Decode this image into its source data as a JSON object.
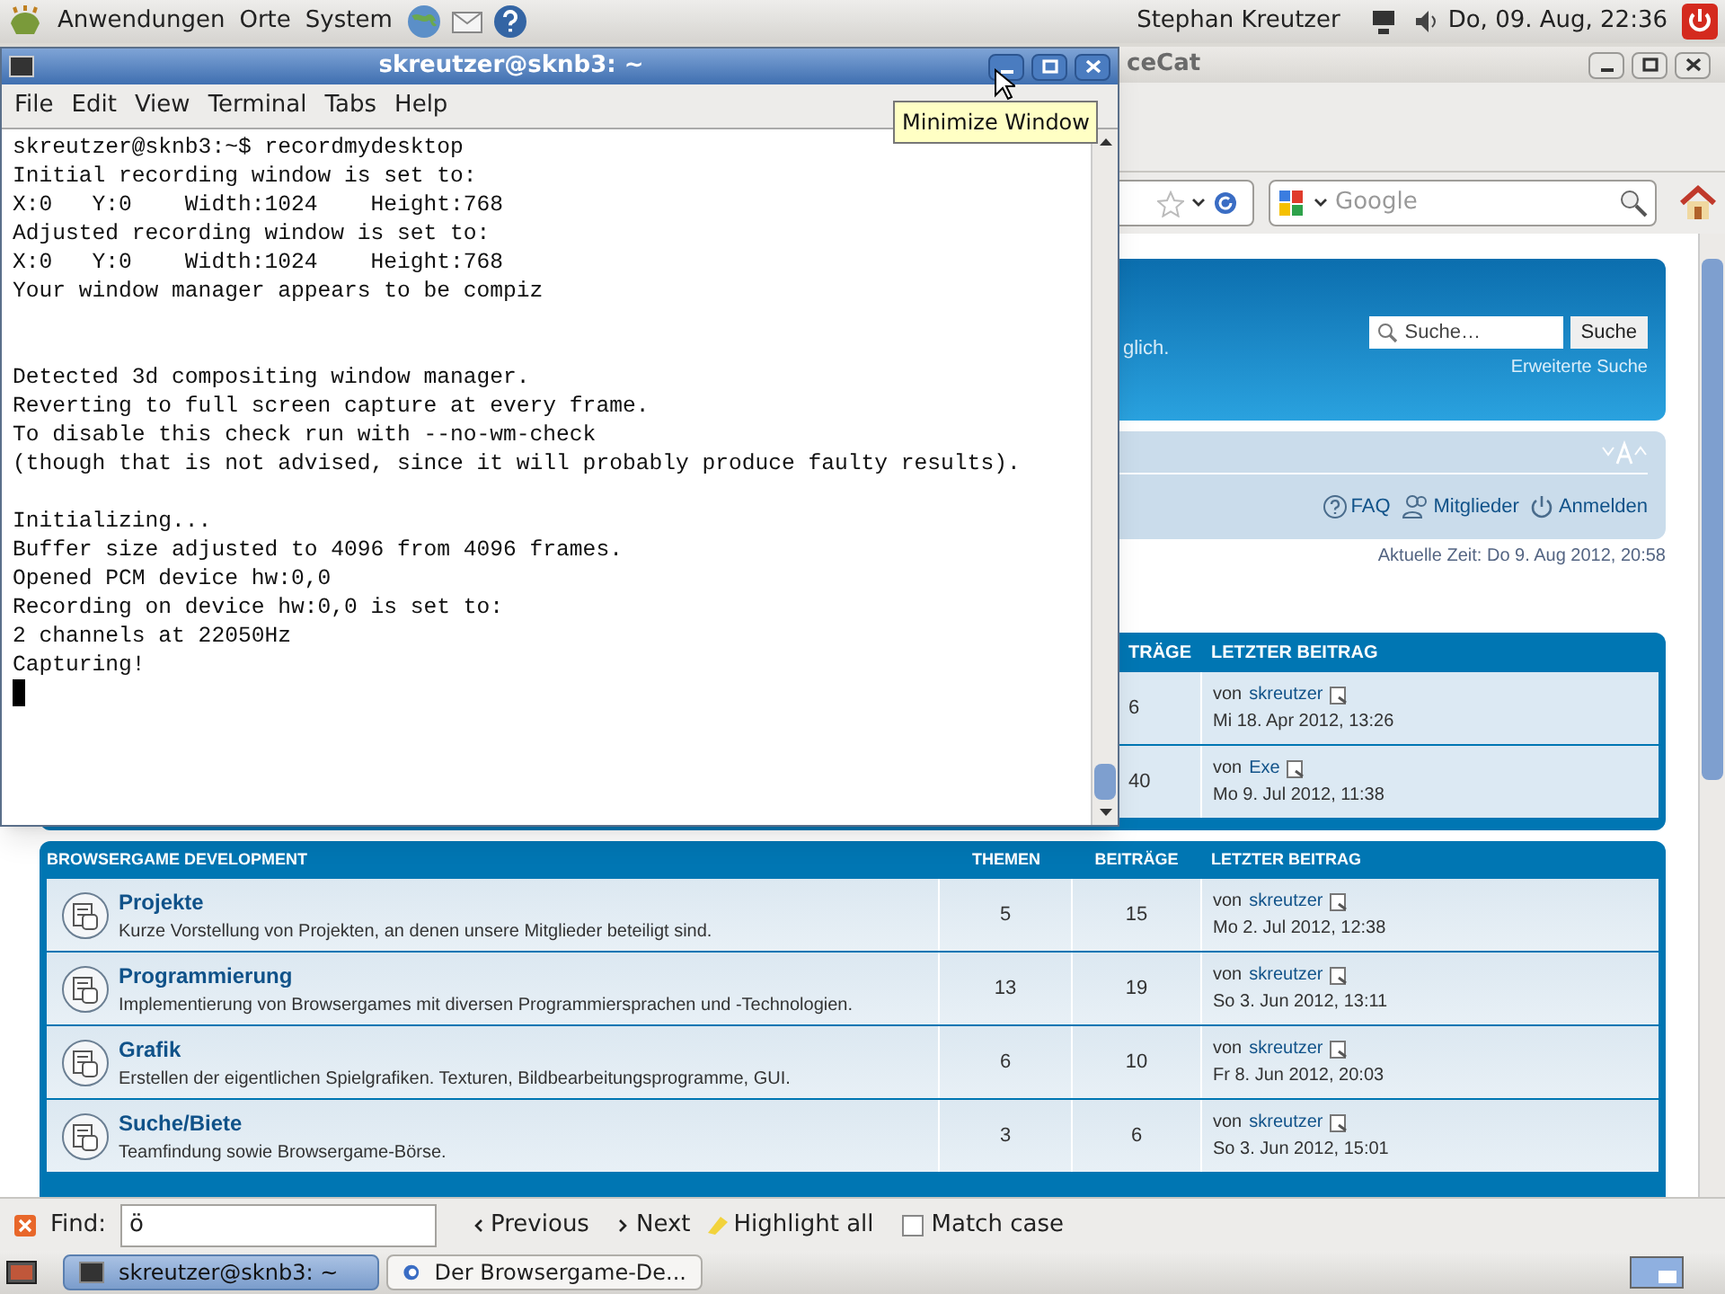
{
  "top_panel": {
    "menus": [
      "Anwendungen",
      "Orte",
      "System"
    ],
    "user": "Stephan Kreutzer",
    "clock": "Do, 09. Aug, 22:36"
  },
  "browser": {
    "title": "ceCat",
    "search_placeholder": "Google",
    "header": {
      "text": "glich.",
      "search_placeholder": "Suche…",
      "search_button": "Suche",
      "advanced_link": "Erweiterte Suche"
    },
    "nav_links": [
      {
        "kind": "faq",
        "label": "FAQ"
      },
      {
        "kind": "members",
        "label": "Mitglieder"
      },
      {
        "kind": "login",
        "label": "Anmelden"
      }
    ],
    "current_time": "Aktuelle Zeit: Do 9. Aug 2012, 20:58",
    "forum_1": {
      "columns": [
        "TRÄGE",
        "LETZTER BEITRAG"
      ],
      "rows": [
        {
          "posts": "6",
          "by": "von",
          "user": "skreutzer",
          "date": "Mi 18. Apr 2012, 13:26"
        },
        {
          "posts": "40",
          "by": "von",
          "user": "Exe",
          "date": "Mo 9. Jul 2012, 11:38"
        }
      ]
    },
    "forum_2": {
      "columns": [
        "BROWSERGAME DEVELOPMENT",
        "THEMEN",
        "BEITRÄGE",
        "LETZTER BEITRAG"
      ],
      "rows": [
        {
          "title": "Projekte",
          "description": "Kurze Vorstellung von Projekten, an denen unsere Mitglieder beteiligt sind.",
          "topics": "5",
          "posts": "15",
          "by": "von",
          "user": "skreutzer",
          "date": "Mo 2. Jul 2012, 12:38"
        },
        {
          "title": "Programmierung",
          "description": "Implementierung von Browsergames mit diversen Programmiersprachen und -Technologien.",
          "topics": "13",
          "posts": "19",
          "by": "von",
          "user": "skreutzer",
          "date": "So 3. Jun 2012, 13:11"
        },
        {
          "title": "Grafik",
          "description": "Erstellen der eigentlichen Spielgrafiken. Texturen, Bildbearbeitungsprogramme, GUI.",
          "topics": "6",
          "posts": "10",
          "by": "von",
          "user": "skreutzer",
          "date": "Fr 8. Jun 2012, 20:03"
        },
        {
          "title": "Suche/Biete",
          "description": "Teamfindung sowie Browsergame-Börse.",
          "topics": "3",
          "posts": "6",
          "by": "von",
          "user": "skreutzer",
          "date": "So 3. Jun 2012, 15:01"
        }
      ]
    },
    "find_bar": {
      "label": "Find:",
      "value": "ö",
      "previous": "Previous",
      "next": "Next",
      "highlight": "Highlight all",
      "match_case": {
        "label": "Match case",
        "checked": false
      }
    }
  },
  "terminal": {
    "title": "skreutzer@sknb3: ~",
    "menus": [
      "File",
      "Edit",
      "View",
      "Terminal",
      "Tabs",
      "Help"
    ],
    "blocks": [
      {
        "lines": [
          "skreutzer@sknb3:~$ recordmydesktop",
          "Initial recording window is set to:",
          "X:0   Y:0    Width:1024    Height:768",
          "Adjusted recording window is set to:",
          "X:0   Y:0    Width:1024    Height:768",
          "Your window manager appears to be compiz"
        ]
      },
      {
        "lines": [
          "Detected 3d compositing window manager.",
          "Reverting to full screen capture at every frame.",
          "To disable this check run with --no-wm-check",
          "(though that is not advised, since it will probably produce faulty results)."
        ]
      },
      {
        "lines": [
          "Initializing...",
          "Buffer size adjusted to 4096 from 4096 frames.",
          "Opened PCM device hw:0,0",
          "Recording on device hw:0,0 is set to:",
          "2 channels at 22050Hz",
          "Capturing!"
        ]
      }
    ]
  },
  "tooltip": "Minimize Window",
  "taskbar": {
    "tasks": [
      {
        "kind": "terminal",
        "label": "skreutzer@sknb3: ~",
        "selected": true
      },
      {
        "kind": "browser",
        "label": "Der Browsergame-De...",
        "selected": false
      }
    ]
  }
}
